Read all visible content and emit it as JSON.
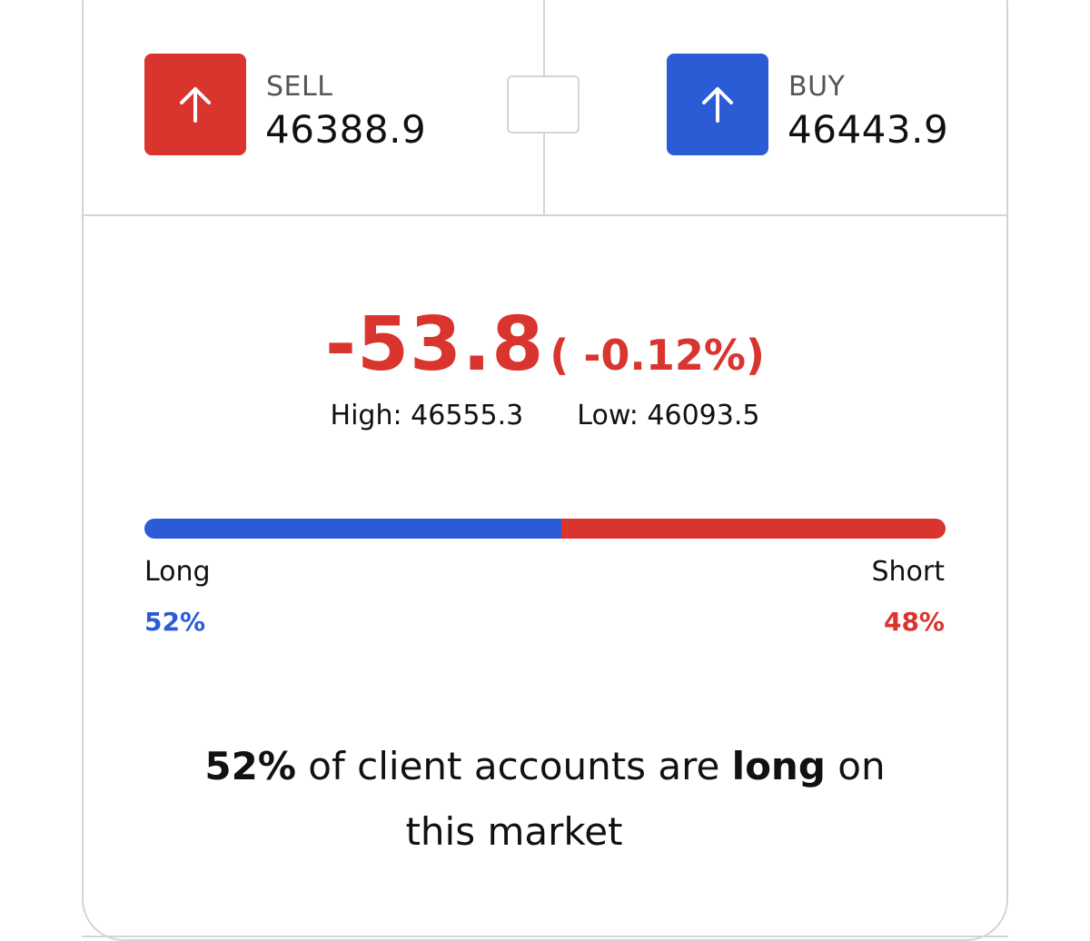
{
  "colors": {
    "sell": "#d9352e",
    "buy": "#2b5cd6",
    "change_negative": "#d9352e",
    "long": "#2b5cd6",
    "short": "#d9352e",
    "border": "#d4d4d4"
  },
  "sell": {
    "label": "SELL",
    "price": "46388.9",
    "icon": "arrow-up-icon"
  },
  "buy": {
    "label": "BUY",
    "price": "46443.9",
    "icon": "arrow-up-icon"
  },
  "change": {
    "value": "-53.8",
    "percent": "( -0.12%)"
  },
  "range": {
    "high_label": "High:",
    "high_value": "46555.3",
    "low_label": "Low:",
    "low_value": "46093.5"
  },
  "sentiment": {
    "long_label": "Long",
    "short_label": "Short",
    "long_pct": "52%",
    "short_pct": "48%",
    "long_fraction": 0.52,
    "short_fraction": 0.48
  },
  "summary": {
    "pct": "52%",
    "text_before": " of client accounts are ",
    "emphasis": "long",
    "text_after": " on",
    "line2": "this market"
  }
}
